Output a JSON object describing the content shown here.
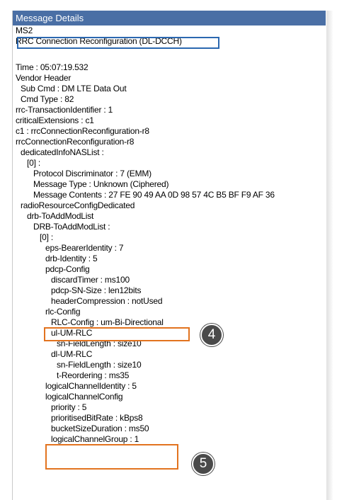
{
  "panel": {
    "title": "Message Details"
  },
  "message": {
    "lines": [
      "MS2",
      "RRC Connection Reconfiguration (DL-DCCH)",
      "",
      "Time : 05:07:19.532",
      "Vendor Header",
      "  Sub Cmd : DM LTE Data Out",
      "  Cmd Type : 82",
      "rrc-TransactionIdentifier : 1",
      "criticalExtensions : c1",
      "c1 : rrcConnectionReconfiguration-r8",
      "rrcConnectionReconfiguration-r8",
      "  dedicatedInfoNASList :",
      "    [0] :",
      "      Protocol Discriminator : 7 (EMM)",
      "      Message Type : Unknown (Ciphered)",
      "      Message Contents : 27 FE 90 49 AA 0D 98 57 4C B5 BF F9 AF 36",
      "  radioResourceConfigDedicated",
      "    drb-ToAddModList",
      "      DRB-ToAddModList :",
      "        [0] :",
      "          eps-BearerIdentity : 7",
      "          drb-Identity : 5",
      "          pdcp-Config",
      "            discardTimer : ms100",
      "            pdcp-SN-Size : len12bits",
      "            headerCompression : notUsed",
      "          rlc-Config",
      "            RLC-Config : um-Bi-Directional",
      "            ul-UM-RLC",
      "              sn-FieldLength : size10",
      "            dl-UM-RLC",
      "              sn-FieldLength : size10",
      "              t-Reordering : ms35",
      "          logicalChannelIdentity : 5",
      "          logicalChannelConfig",
      "            priority : 5",
      "            prioritisedBitRate : kBps8",
      "            bucketSizeDuration : ms50",
      "            logicalChannelGroup : 1"
    ]
  },
  "annotations": {
    "badge_4": "4",
    "badge_5": "5"
  },
  "colors": {
    "title_bar": "#4a6fa5",
    "highlight_blue": "#2b68b0",
    "highlight_orange": "#e2731f",
    "badge": "#4a4a4a"
  }
}
